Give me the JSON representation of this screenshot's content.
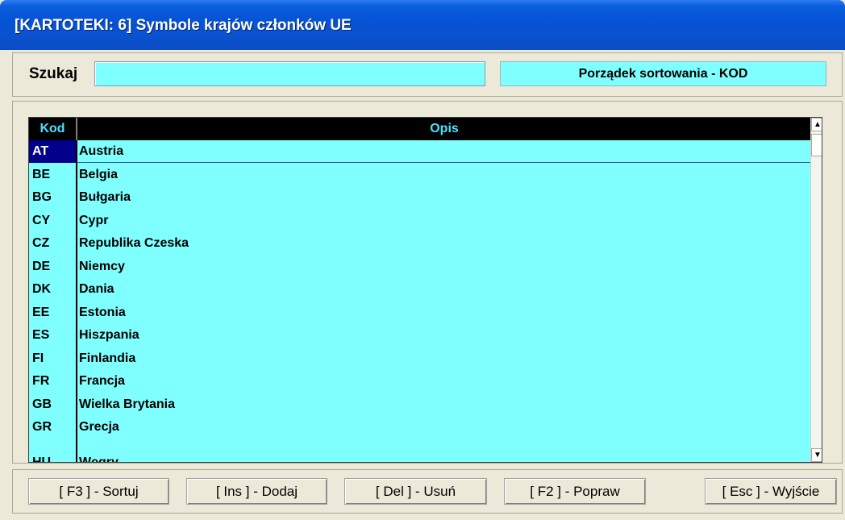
{
  "window": {
    "title": "[KARTOTEKI: 6]  Symbole krajów członków UE"
  },
  "search": {
    "label": "Szukaj",
    "value": "",
    "sort_status": "Porządek sortowania - KOD"
  },
  "grid": {
    "columns": [
      "Kod",
      "Opis"
    ],
    "selected_index": 0,
    "rows": [
      {
        "kod": "AT",
        "opis": "Austria"
      },
      {
        "kod": "BE",
        "opis": "Belgia"
      },
      {
        "kod": "BG",
        "opis": "Bułgaria"
      },
      {
        "kod": "CY",
        "opis": "Cypr"
      },
      {
        "kod": "CZ",
        "opis": "Republika Czeska"
      },
      {
        "kod": "DE",
        "opis": "Niemcy"
      },
      {
        "kod": "DK",
        "opis": "Dania"
      },
      {
        "kod": "EE",
        "opis": "Estonia"
      },
      {
        "kod": "ES",
        "opis": "Hiszpania"
      },
      {
        "kod": "FI",
        "opis": "Finlandia"
      },
      {
        "kod": "FR",
        "opis": "Francja"
      },
      {
        "kod": "GB",
        "opis": "Wielka Brytania"
      },
      {
        "kod": "GR",
        "opis": "Grecja"
      },
      {
        "kod": "HU",
        "opis": "Węgry"
      }
    ]
  },
  "buttons": {
    "sort": "[ F3 ] - Sortuj",
    "add": "[ Ins ] - Dodaj",
    "delete": "[ Del ] - Usuń",
    "edit": "[ F2 ] - Popraw",
    "exit": "[ Esc ] - Wyjście"
  },
  "colors": {
    "title_bar": "#0553d6",
    "grid_background": "#80ffff",
    "header_background": "#000000",
    "header_text": "#4fe0ff",
    "selected_code": "#00008b"
  }
}
